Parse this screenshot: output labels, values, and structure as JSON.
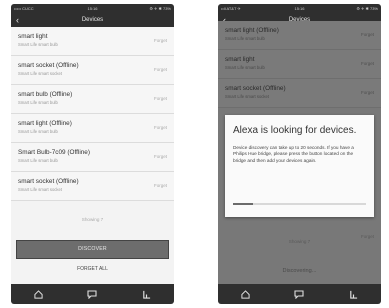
{
  "left": {
    "status": {
      "carrier": "••••• CUCC",
      "time": "15:16",
      "right": "⚙ ✈ ✱ 73%"
    },
    "title": "Devices",
    "devices": [
      {
        "name": "smart light",
        "sub": "Smart Life smart bulb",
        "action": "Forget"
      },
      {
        "name": "smart socket (Offline)",
        "sub": "Smart Life smart socket",
        "action": "Forget"
      },
      {
        "name": "smart bulb (Offline)",
        "sub": "Smart Life smart bulb",
        "action": "Forget"
      },
      {
        "name": "smart light (Offline)",
        "sub": "Smart Life smart bulb",
        "action": "Forget"
      },
      {
        "name": "Smart Bulb-7c09 (Offline)",
        "sub": "Smart Life smart bulb",
        "action": "Forget"
      },
      {
        "name": "smart socket (Offline)",
        "sub": "Smart Life smart socket",
        "action": "Forget"
      }
    ],
    "showing": "Showing 7",
    "discover": "DISCOVER",
    "forget_all": "FORGET ALL"
  },
  "right": {
    "status": {
      "carrier": "••ll AT&T ✈",
      "time": "15:16",
      "right": "⚙ ✈ ✱ 73%"
    },
    "title": "Devices",
    "devices": [
      {
        "name": "smart light (Offline)",
        "sub": "Smart Life smart bulb",
        "action": "Forget"
      },
      {
        "name": "smart light",
        "sub": "Smart Life smart bulb",
        "action": "Forget"
      },
      {
        "name": "smart socket (Offline)",
        "sub": "Smart Life smart socket",
        "action": "Forget"
      }
    ],
    "hidden_forget_1": "Forget",
    "hidden_forget_2": "Forget",
    "showing": "Showing 7",
    "discovering": "Discovering...",
    "modal": {
      "title": "Alexa is looking for devices.",
      "body": "Device discovery can take up to 20 seconds. If you have a Philips Hue bridge, please press the button located on the bridge and then add your devices again.",
      "progress": 0.15
    }
  },
  "tabs": {
    "home": "home-icon",
    "chat": "chat-icon",
    "devices": "devices-icon"
  }
}
